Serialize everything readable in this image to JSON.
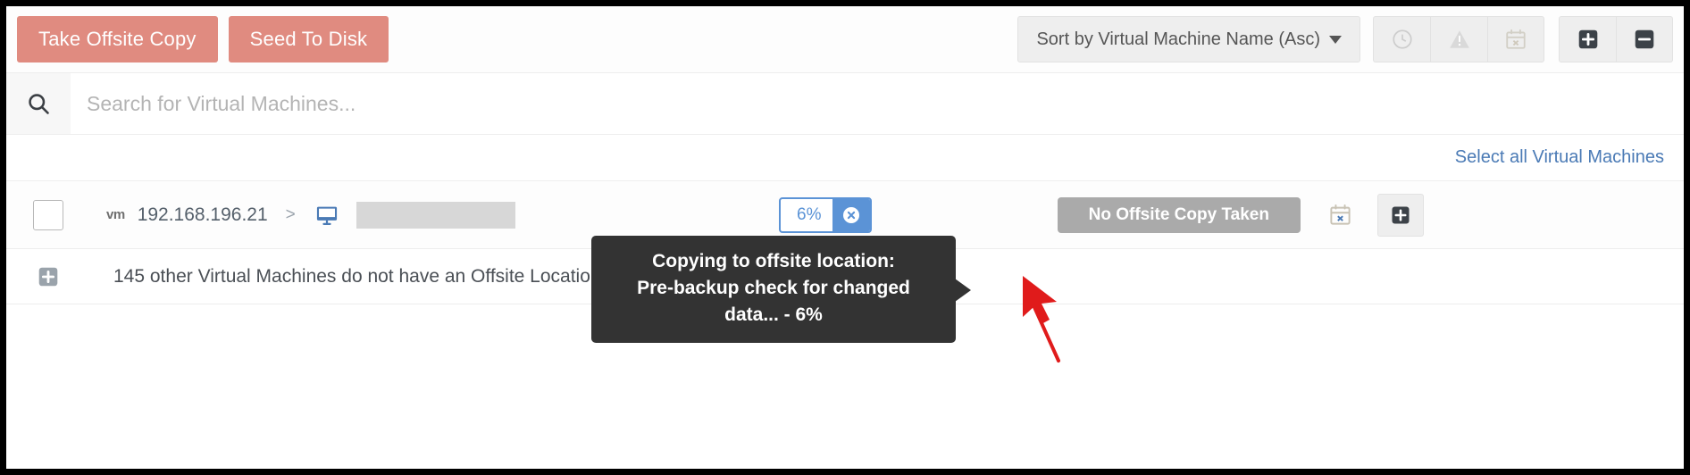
{
  "toolbar": {
    "take_offsite_copy": "Take Offsite Copy",
    "seed_to_disk": "Seed To Disk",
    "sort_label": "Sort by Virtual Machine Name (Asc)",
    "icons": {
      "history": "clock-icon",
      "warning": "warning-triangle-icon",
      "no_schedule": "calendar-x-icon",
      "expand_all": "plus-square-icon",
      "collapse_all": "minus-square-icon"
    }
  },
  "search": {
    "placeholder": "Search for Virtual Machines...",
    "value": "",
    "icon": "search-icon"
  },
  "select_all": {
    "label": "Select all Virtual Machines"
  },
  "vm_row": {
    "checkbox_checked": false,
    "type_tag": "vm",
    "host": "192.168.196.21",
    "separator": ">",
    "machine_icon": "monitor-icon",
    "machine_name": "",
    "progress_percent": "6%",
    "cancel_icon": "cancel-circle-icon",
    "status": "No Offsite Copy Taken",
    "schedule_icon": "calendar-x-icon",
    "add_icon": "plus-square-icon"
  },
  "tooltip": {
    "line1": "Copying to offsite location:",
    "line2": "Pre-backup check for changed",
    "line3": "data... - 6%"
  },
  "other_vms": {
    "expand_icon": "plus-square-icon",
    "text": "145 other Virtual Machines do not have an Offsite Location set."
  },
  "colors": {
    "primary_button": "#e08b80",
    "link": "#4a7ab5",
    "progress_accent": "#5b93d6",
    "status_badge": "#aaaaaa",
    "tooltip_bg": "#333333",
    "annotation_arrow": "#e01b1b"
  }
}
